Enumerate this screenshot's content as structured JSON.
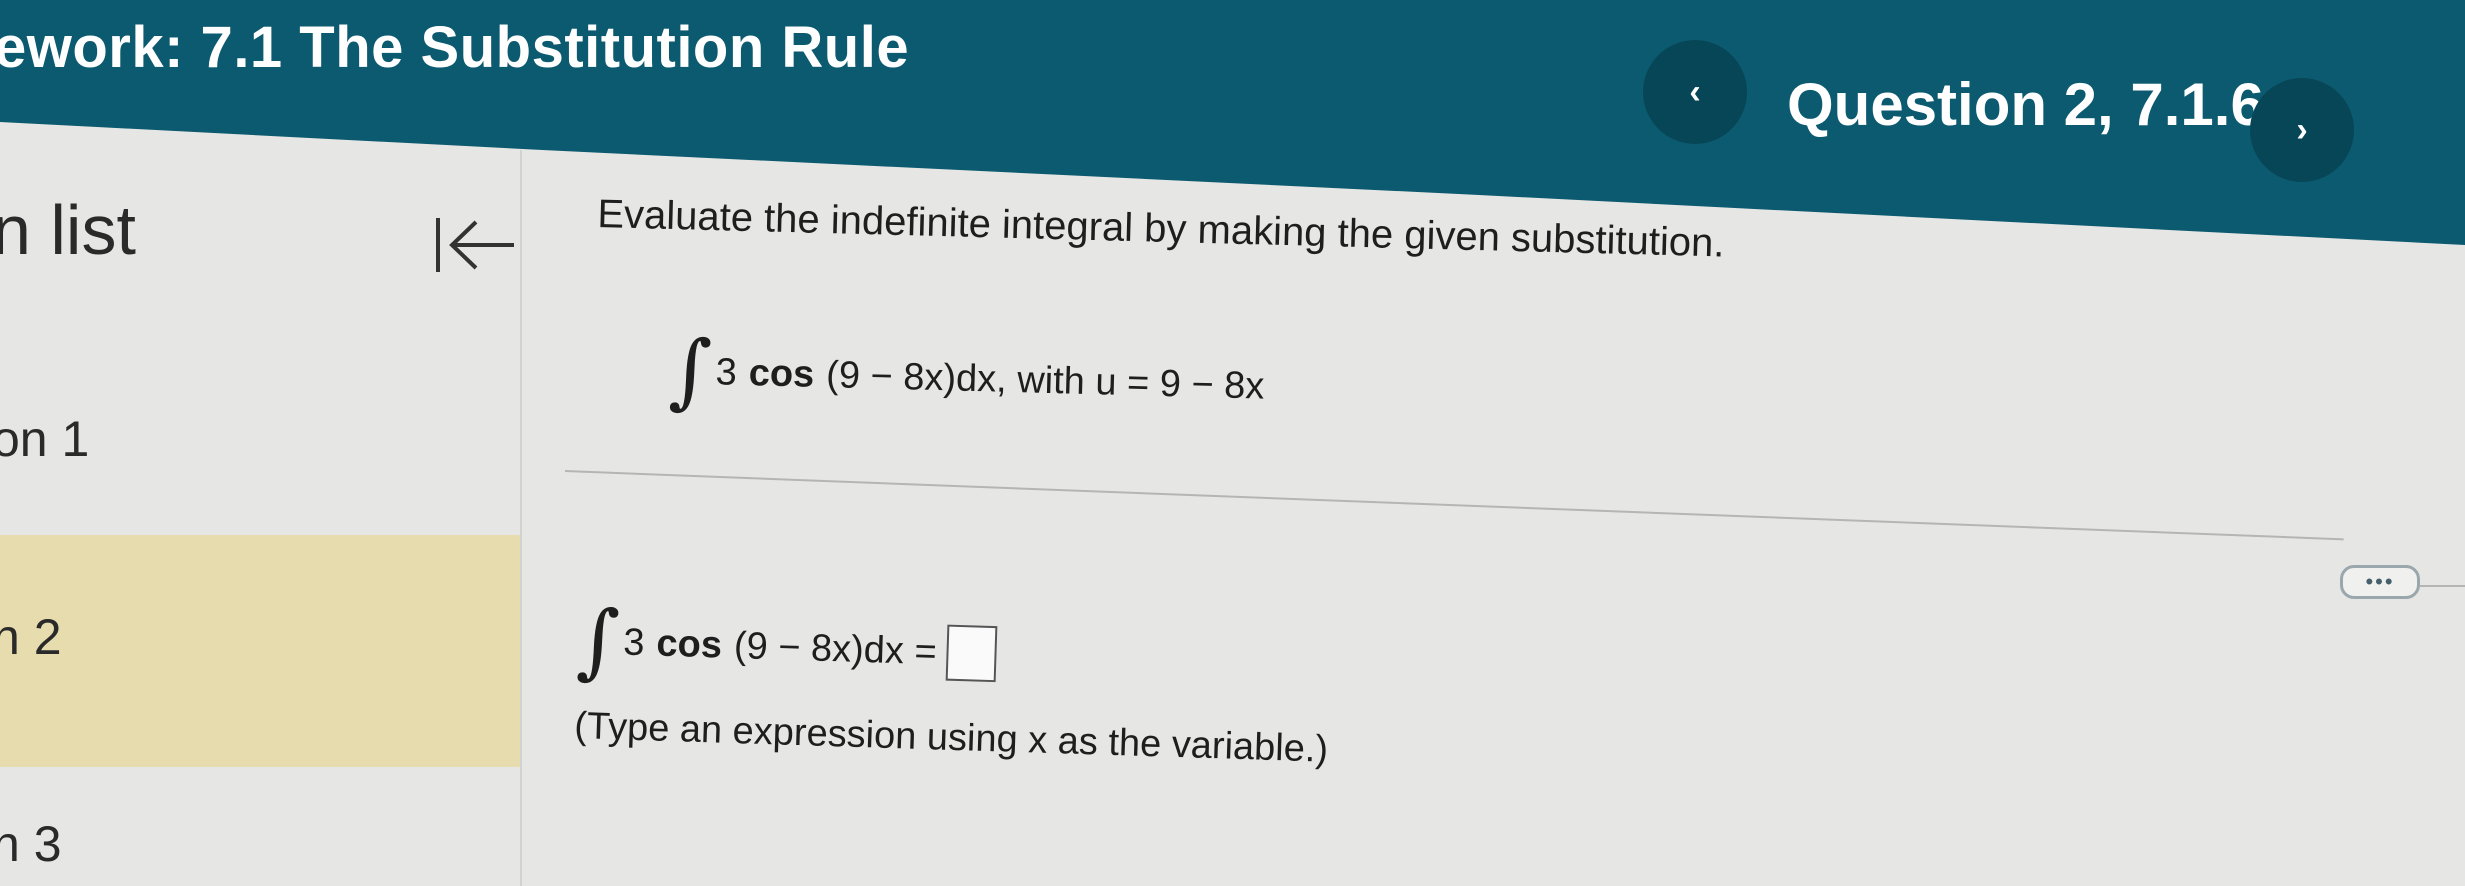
{
  "header": {
    "homework_title": "ework: 7.1 The Substitution Rule",
    "question_label": "Question 2, 7.1.6",
    "prev_label": "‹",
    "next_label": "›"
  },
  "sidebar": {
    "title": "n list",
    "collapse_icon": "collapse-left-arrow-icon",
    "items": [
      {
        "label": "on 1",
        "selected": false
      },
      {
        "label": "n 2",
        "selected": true
      },
      {
        "label": "n 3",
        "selected": false
      }
    ]
  },
  "question": {
    "instruction": "Evaluate the indefinite integral by making the given substitution.",
    "integral_symbol": "∫",
    "coefficient": "3",
    "function": "cos",
    "argument": "(9 − 8x)dx, with u = 9 − 8x",
    "more_label": "•••",
    "answer_argument": "(9 − 8x)dx =",
    "hint": "(Type an expression using x as the variable.)"
  },
  "colors": {
    "header": "#0b5a70",
    "nav_button": "#074657",
    "selected_item": "#e7dcae",
    "background": "#e6e6e4"
  }
}
